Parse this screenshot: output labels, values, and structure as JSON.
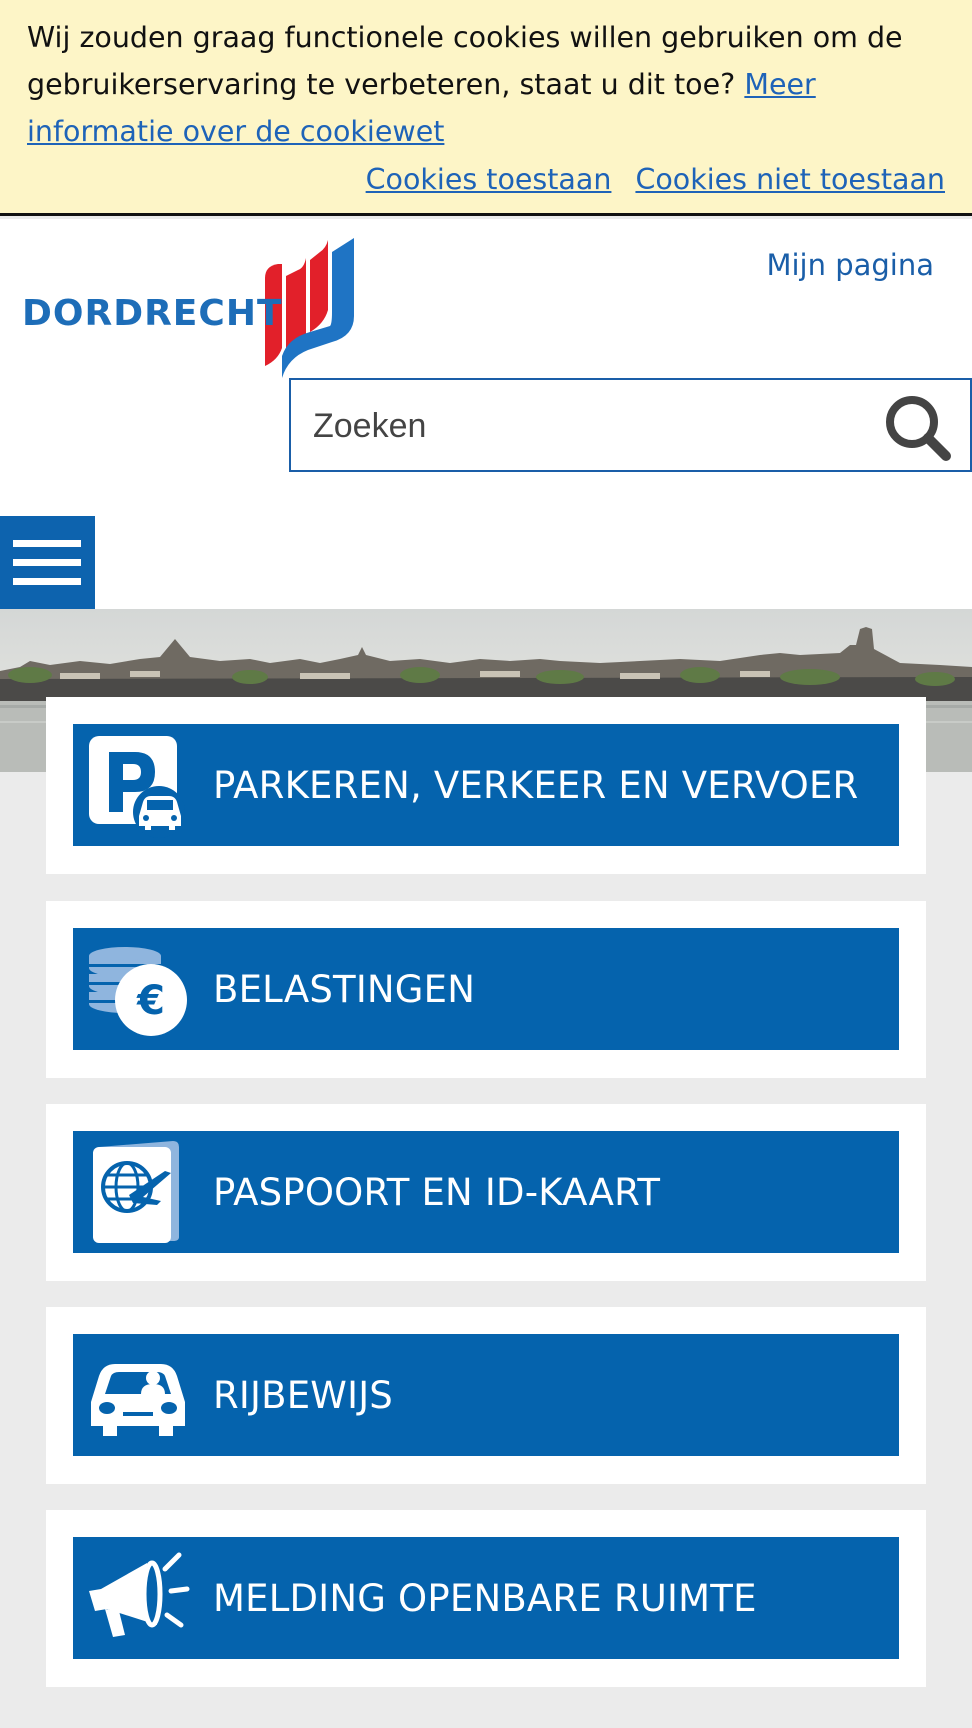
{
  "cookie_bar": {
    "message": "Wij zouden graag functionele cookies willen gebruiken om de gebruikerservaring te verbeteren, staat u dit toe?",
    "info_link": "Meer informatie over de cookiewet",
    "allow_label": "Cookies toestaan",
    "deny_label": "Cookies niet toestaan"
  },
  "header": {
    "logo_text": "DORDRECHT",
    "mijn_pagina": "Mijn pagina",
    "search_placeholder": "Zoeken",
    "search_icon": "search-icon",
    "menu_icon": "hamburger-menu-icon"
  },
  "colors": {
    "brand_blue": "#0563ad",
    "brand_red": "#e2202a",
    "cookie_bg": "#fdf5c7",
    "page_bg": "#ebebeb"
  },
  "tiles": [
    {
      "label": "PARKEREN, VERKEER EN VERVOER",
      "icon": "parking-car-icon"
    },
    {
      "label": "BELASTINGEN",
      "icon": "coins-euro-icon"
    },
    {
      "label": "PASPOORT EN ID-KAART",
      "icon": "passport-icon"
    },
    {
      "label": "RIJBEWIJS",
      "icon": "car-driver-icon"
    },
    {
      "label": "MELDING OPENBARE RUIMTE",
      "icon": "megaphone-icon"
    }
  ]
}
